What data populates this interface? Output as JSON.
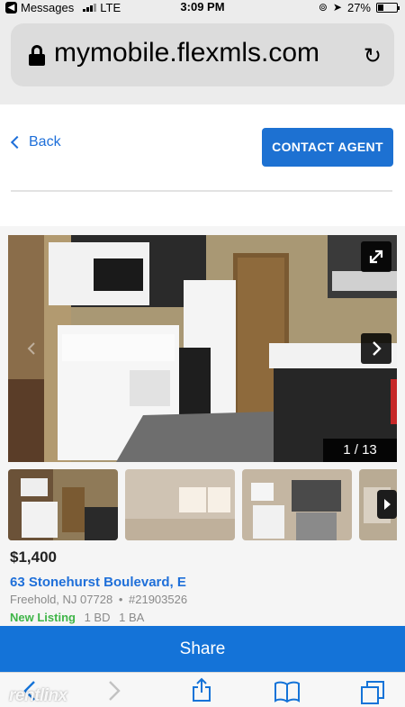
{
  "status_bar": {
    "carrier": "Messages",
    "network": "LTE",
    "time": "3:09 PM",
    "battery": "27%",
    "battery_level": 0.27
  },
  "browser": {
    "url": "mymobile.flexmls.com"
  },
  "page_header": {
    "back_label": "Back",
    "contact_label": "CONTACT AGENT"
  },
  "gallery": {
    "counter": "1 / 13"
  },
  "listing": {
    "price": "$1,400",
    "address": "63 Stonehurst Boulevard, E",
    "city": "Freehold, NJ 07728",
    "separator": "•",
    "mls_number": "#21903526",
    "status": "New Listing",
    "beds": "1 BD",
    "baths": "1 BA"
  },
  "share_label": "Share",
  "watermark": "rentlinx",
  "colors": {
    "accent": "#1d71d2",
    "link": "#1e6fd9",
    "new_listing": "#3fb548"
  }
}
